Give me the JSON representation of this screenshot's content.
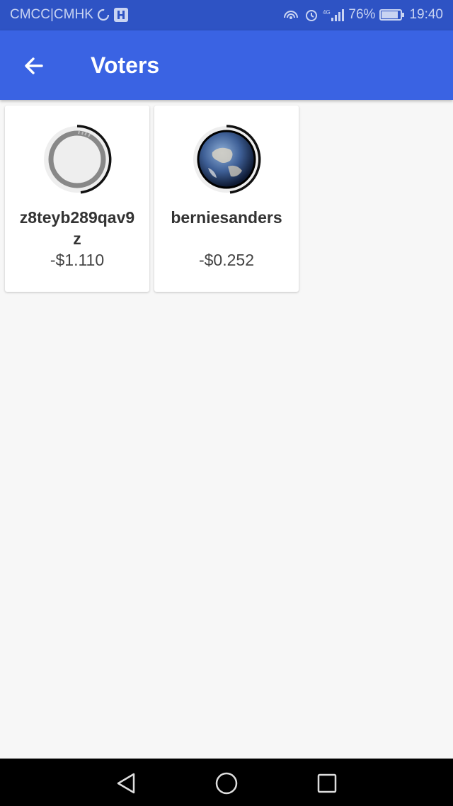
{
  "status_bar": {
    "carrier": "CMCC|CMHK",
    "battery": "76%",
    "time": "19:40",
    "network": "4G"
  },
  "app_bar": {
    "title": "Voters",
    "back_icon": "arrow-left-icon",
    "background": "#3a63e3"
  },
  "voters": [
    {
      "name": "z8teyb289qav9z",
      "payout": "-$1.110",
      "avatar": "default-ring-avatar"
    },
    {
      "name": "berniesanders",
      "payout": "-$0.252",
      "avatar": "earth-avatar"
    }
  ],
  "nav_bar": {
    "back_icon": "triangle-back-icon",
    "home_icon": "circle-home-icon",
    "recents_icon": "square-recents-icon"
  }
}
